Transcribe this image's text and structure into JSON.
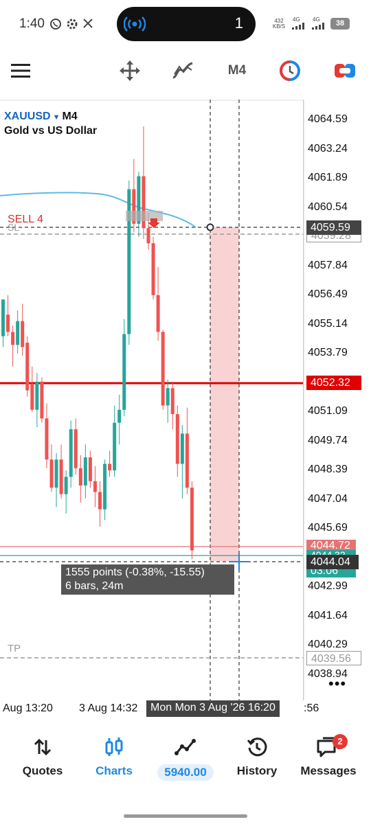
{
  "status_bar": {
    "time": "1:40",
    "call_count": "1",
    "net_speed": "432\nKB/S",
    "net1": "4G",
    "net2": "4G",
    "battery": "38"
  },
  "toolbar": {
    "period": "M4"
  },
  "chart": {
    "symbol": "XAUUSD",
    "timeframe": "M4",
    "description": "Gold vs US Dollar",
    "sell_label": "SELL 4",
    "sl_label": "SL",
    "tp_label": "TP",
    "price_ticks": [
      "4064.59",
      "4063.24",
      "4061.89",
      "4060.54",
      "4057.84",
      "4056.49",
      "4055.14",
      "4053.79",
      "4051.09",
      "4049.74",
      "4048.39",
      "4047.04",
      "4045.69",
      "4042.99",
      "4041.64",
      "4040.29",
      "4038.94"
    ],
    "tag_crosshair": "4059.59",
    "tag_sl": "4059.28",
    "tag_sell": "4052.32",
    "tag_ask": "4044.72",
    "tag_bid_hidden": "4044.32",
    "tag_crosshair_low": "4044.04",
    "tag_timer": "03:06",
    "tag_tp": "4039.56",
    "ruler_line1": "1555 points (-0.38%, -15.55)",
    "ruler_line2": "6 bars, 24m",
    "more": "•••",
    "candles": [
      [
        4054.6,
        4056.2,
        4054.1,
        4056.3
      ],
      [
        4055.6,
        4056.5,
        4054.6,
        4054.8
      ],
      [
        4054.8,
        4055.1,
        4053.2,
        4054.2
      ],
      [
        4054.2,
        4055.8,
        4053.8,
        4055.3
      ],
      [
        4055.3,
        4056.1,
        4053.7,
        4054.1
      ],
      [
        4054.3,
        4054.6,
        4051.8,
        4052.1
      ],
      [
        4052.4,
        4053.2,
        4051.1,
        4051.2
      ],
      [
        4051.2,
        4052.9,
        4050.4,
        4052.5
      ],
      [
        4052.5,
        4052.7,
        4050.6,
        4050.8
      ],
      [
        4050.8,
        4051.5,
        4048.5,
        4048.9
      ],
      [
        4048.9,
        4049.6,
        4047.4,
        4047.6
      ],
      [
        4047.6,
        4049.2,
        4046.7,
        4048.9
      ],
      [
        4048.9,
        4049.6,
        4047.1,
        4047.3
      ],
      [
        4047.3,
        4048.4,
        4046.4,
        4048.1
      ],
      [
        4048.1,
        4050.7,
        4047.6,
        4050.3
      ],
      [
        4050.3,
        4050.8,
        4048.2,
        4048.5
      ],
      [
        4048.5,
        4049.1,
        4046.9,
        4047.7
      ],
      [
        4047.7,
        4049.6,
        4047.1,
        4049.0
      ],
      [
        4049.0,
        4049.3,
        4047.6,
        4047.9
      ],
      [
        4047.9,
        4048.6,
        4046.7,
        4047.4
      ],
      [
        4047.4,
        4047.9,
        4045.8,
        4046.6
      ],
      [
        4046.6,
        4048.9,
        4046.1,
        4048.7
      ],
      [
        4048.7,
        4049.3,
        4048.1,
        4048.4
      ],
      [
        4048.4,
        4051.4,
        4048.1,
        4050.6
      ],
      [
        4050.6,
        4051.9,
        4049.6,
        4051.2
      ],
      [
        4051.2,
        4055.4,
        4050.9,
        4054.7
      ],
      [
        4054.7,
        4061.8,
        4054.2,
        4061.4
      ],
      [
        4061.4,
        4062.8,
        4059.4,
        4059.8
      ],
      [
        4059.8,
        4062.2,
        4059.2,
        4062.0
      ],
      [
        4062.0,
        4064.3,
        4059.1,
        4059.6
      ],
      [
        4059.6,
        4060.3,
        4058.6,
        4058.9
      ],
      [
        4058.9,
        4059.2,
        4056.3,
        4056.5
      ],
      [
        4056.5,
        4057.8,
        4054.4,
        4054.8
      ],
      [
        4054.8,
        4054.9,
        4051.2,
        4051.4
      ],
      [
        4051.4,
        4052.6,
        4050.6,
        4052.2
      ],
      [
        4052.2,
        4052.5,
        4050.3,
        4051.0
      ],
      [
        4051.0,
        4051.4,
        4048.1,
        4048.7
      ],
      [
        4048.7,
        4050.5,
        4047.1,
        4050.1
      ],
      [
        4050.1,
        4051.3,
        4047.3,
        4047.6
      ],
      [
        4047.6,
        4047.9,
        4044.3,
        4044.7
      ]
    ]
  },
  "time_axis": {
    "label1": "Aug 13:20",
    "label2": "3 Aug 14:32",
    "crosshair": "Mon Mon 3 Aug '26 16:20",
    "label3": ":56"
  },
  "nav": {
    "quotes": "Quotes",
    "charts": "Charts",
    "balance": "5940.00",
    "history": "History",
    "messages": "Messages",
    "messages_badge": "2"
  },
  "colors": {
    "up": "#26a69a",
    "down": "#ef5350",
    "sell_line": "#e00000",
    "accent": "#1e88e5",
    "ma": "#5fb8e8"
  }
}
